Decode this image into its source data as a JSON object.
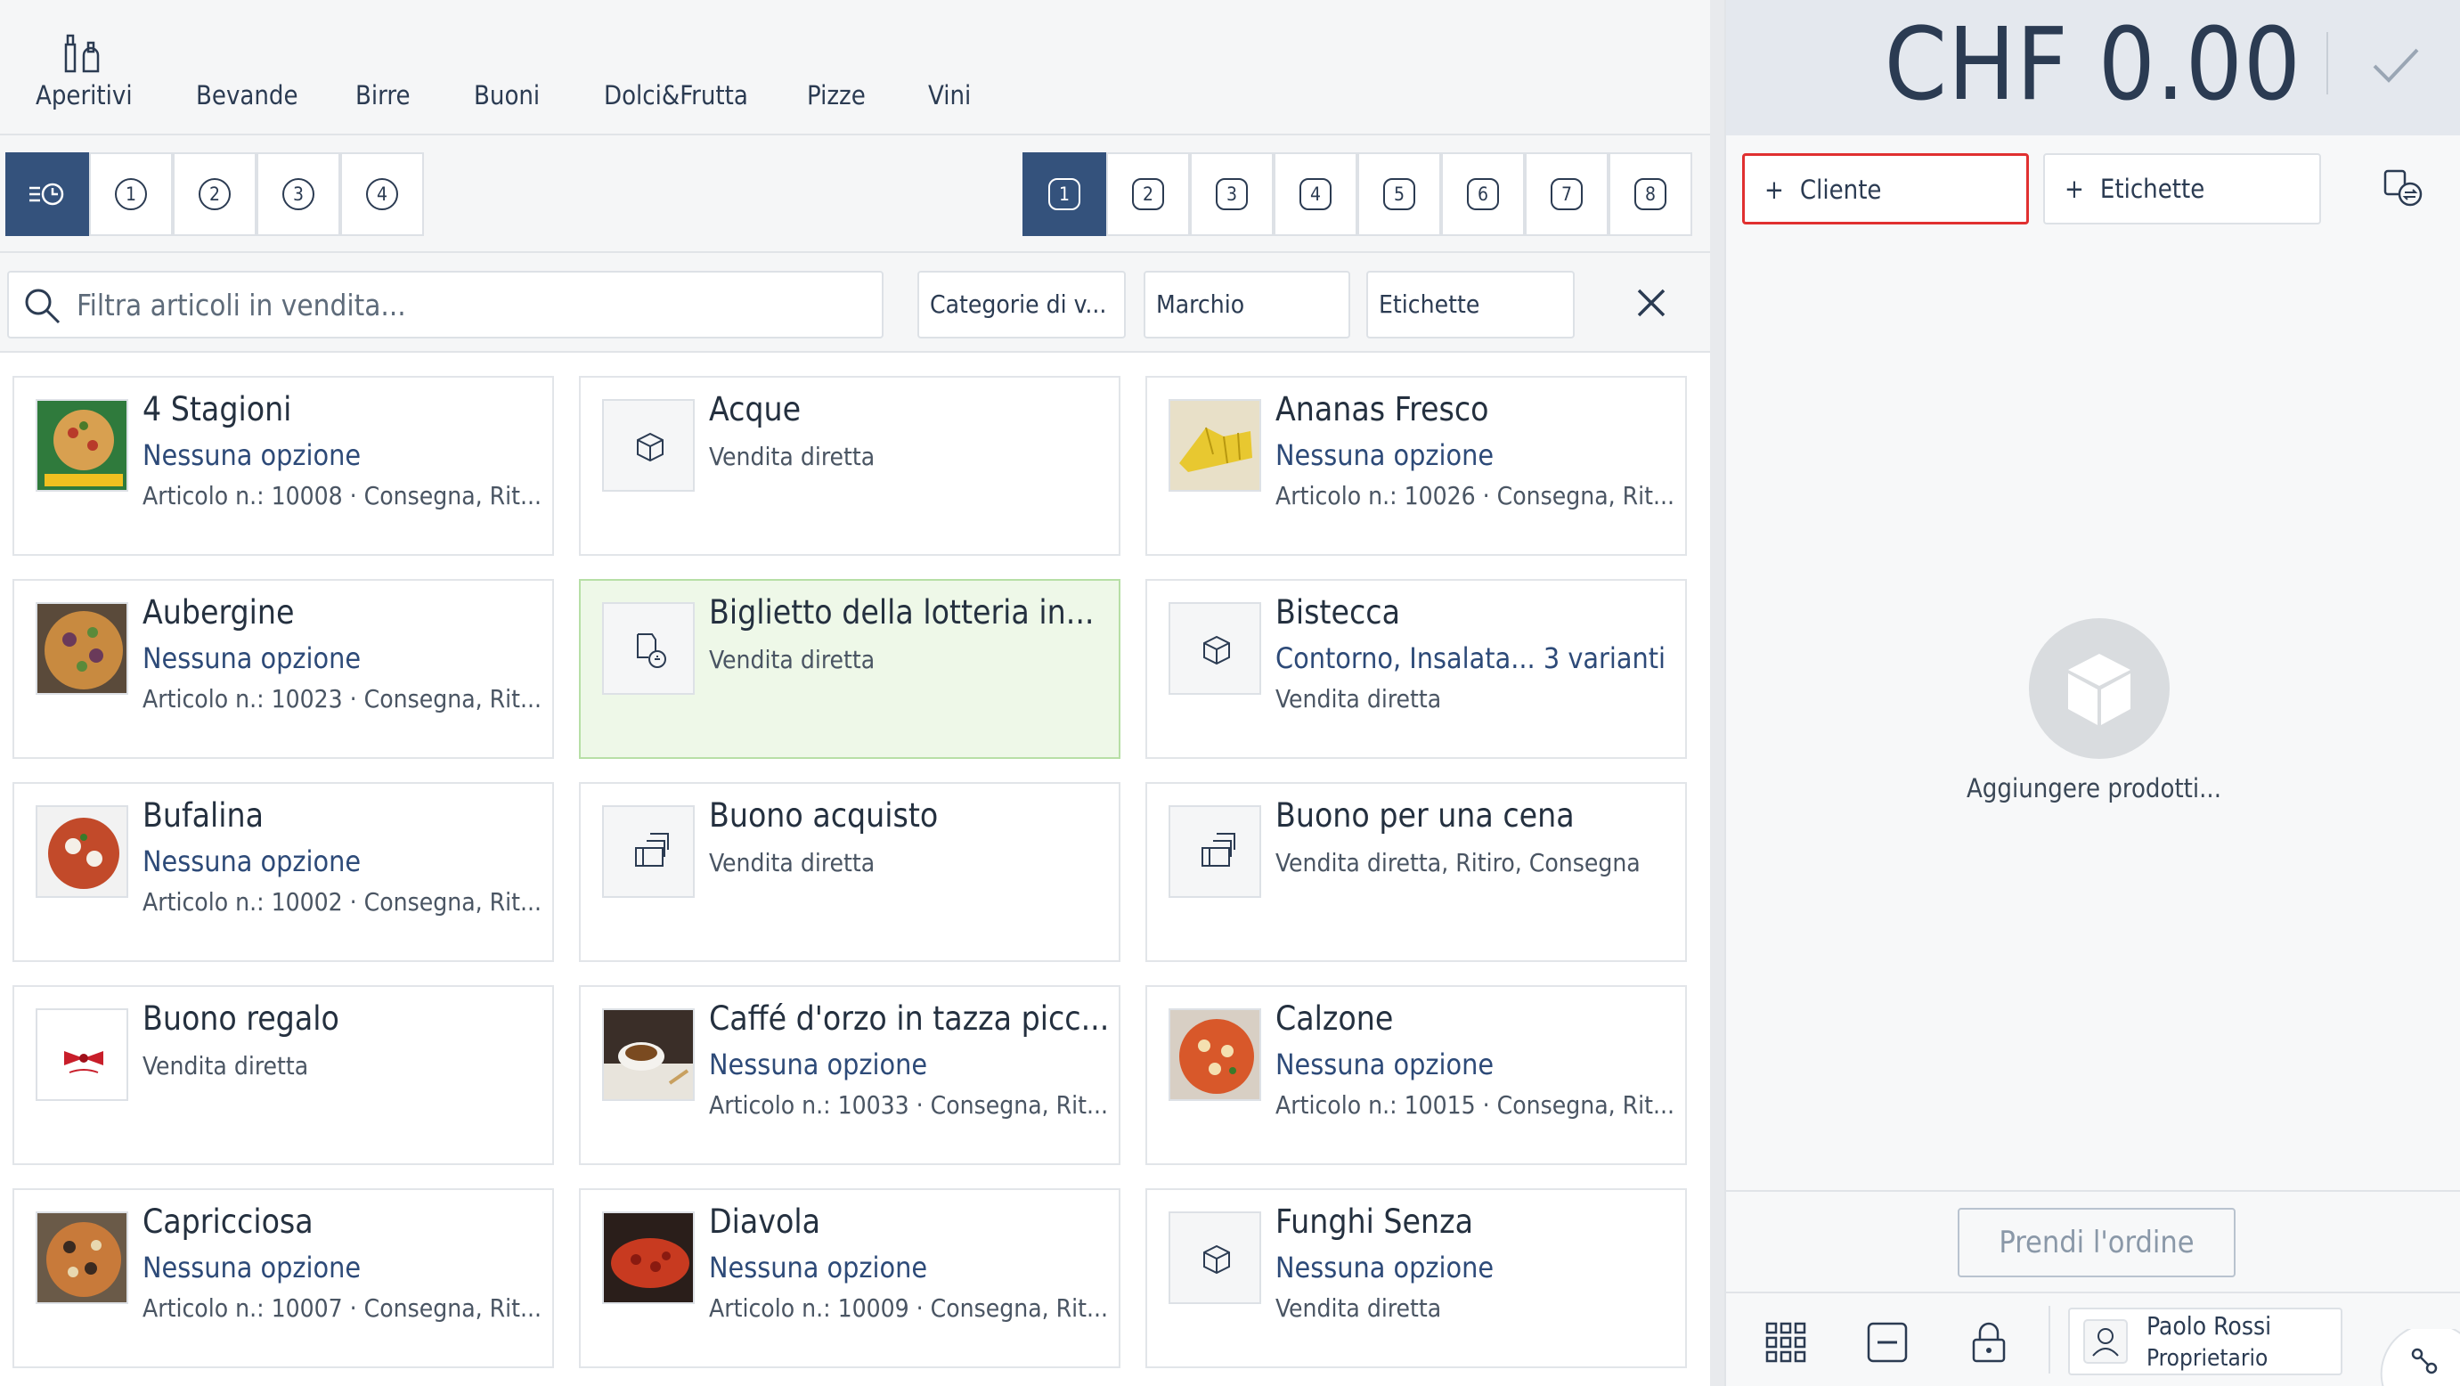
{
  "categories": [
    "Aperitivi",
    "Bevande",
    "Birre",
    "Buoni",
    "Dolci&Frutta",
    "Pizze",
    "Vini"
  ],
  "order_views": [
    "1",
    "2",
    "3",
    "4"
  ],
  "pages": [
    "1",
    "2",
    "3",
    "4",
    "5",
    "6",
    "7",
    "8"
  ],
  "filter": {
    "search_placeholder": "Filtra articoli in vendita...",
    "category_label": "Categorie di v...",
    "brand_label": "Marchio",
    "tags_label": "Etichette"
  },
  "products": [
    {
      "title": "4 Stagioni",
      "option": "Nessuna opzione",
      "meta": "Articolo n.: 10008 · Consegna, Rit..."
    },
    {
      "title": "Acque",
      "option": "",
      "meta": "",
      "plain": "Vendita diretta"
    },
    {
      "title": "Ananas Fresco",
      "option": "Nessuna opzione",
      "meta": "Articolo n.: 10026 · Consegna, Rit..."
    },
    {
      "title": "Aubergine",
      "option": "Nessuna opzione",
      "meta": "Articolo n.: 10023 · Consegna, Rit..."
    },
    {
      "title": "Biglietto della lotteria in...",
      "option": "",
      "meta": "",
      "plain": "Vendita diretta"
    },
    {
      "title": "Bistecca",
      "option": "Contorno, Insalata...",
      "variants": "3 varianti",
      "meta": "Vendita diretta"
    },
    {
      "title": "Bufalina",
      "option": "Nessuna opzione",
      "meta": "Articolo n.: 10002 · Consegna, Rit..."
    },
    {
      "title": "Buono acquisto",
      "option": "",
      "meta": "",
      "plain": "Vendita diretta"
    },
    {
      "title": "Buono per una cena",
      "option": "",
      "meta": "",
      "plain": "Vendita diretta, Ritiro, Consegna"
    },
    {
      "title": "Buono regalo",
      "option": "",
      "meta": "",
      "plain": "Vendita diretta"
    },
    {
      "title": "Caffé d'orzo in tazza picc...",
      "option": "Nessuna opzione",
      "meta": "Articolo n.: 10033 · Consegna, Rit..."
    },
    {
      "title": "Calzone",
      "option": "Nessuna opzione",
      "meta": "Articolo n.: 10015 · Consegna, Rit..."
    },
    {
      "title": "Capricciosa",
      "option": "Nessuna opzione",
      "meta": "Articolo n.: 10007 · Consegna, Rit..."
    },
    {
      "title": "Diavola",
      "option": "Nessuna opzione",
      "meta": "Articolo n.: 10009 · Consegna, Rit..."
    },
    {
      "title": "Funghi Senza",
      "option": "Nessuna opzione",
      "meta": "Vendita diretta"
    }
  ],
  "cart": {
    "total": "CHF 0.00",
    "customer_label": "Cliente",
    "tags_label": "Etichette",
    "empty_text": "Aggiungere prodotti...",
    "take_order_label": "Prendi l'ordine"
  },
  "user": {
    "name": "Paolo Rossi",
    "role": "Proprietario"
  },
  "colors": {
    "accent": "#34527c",
    "highlight": "#eef8e8",
    "focus": "#e03030"
  }
}
